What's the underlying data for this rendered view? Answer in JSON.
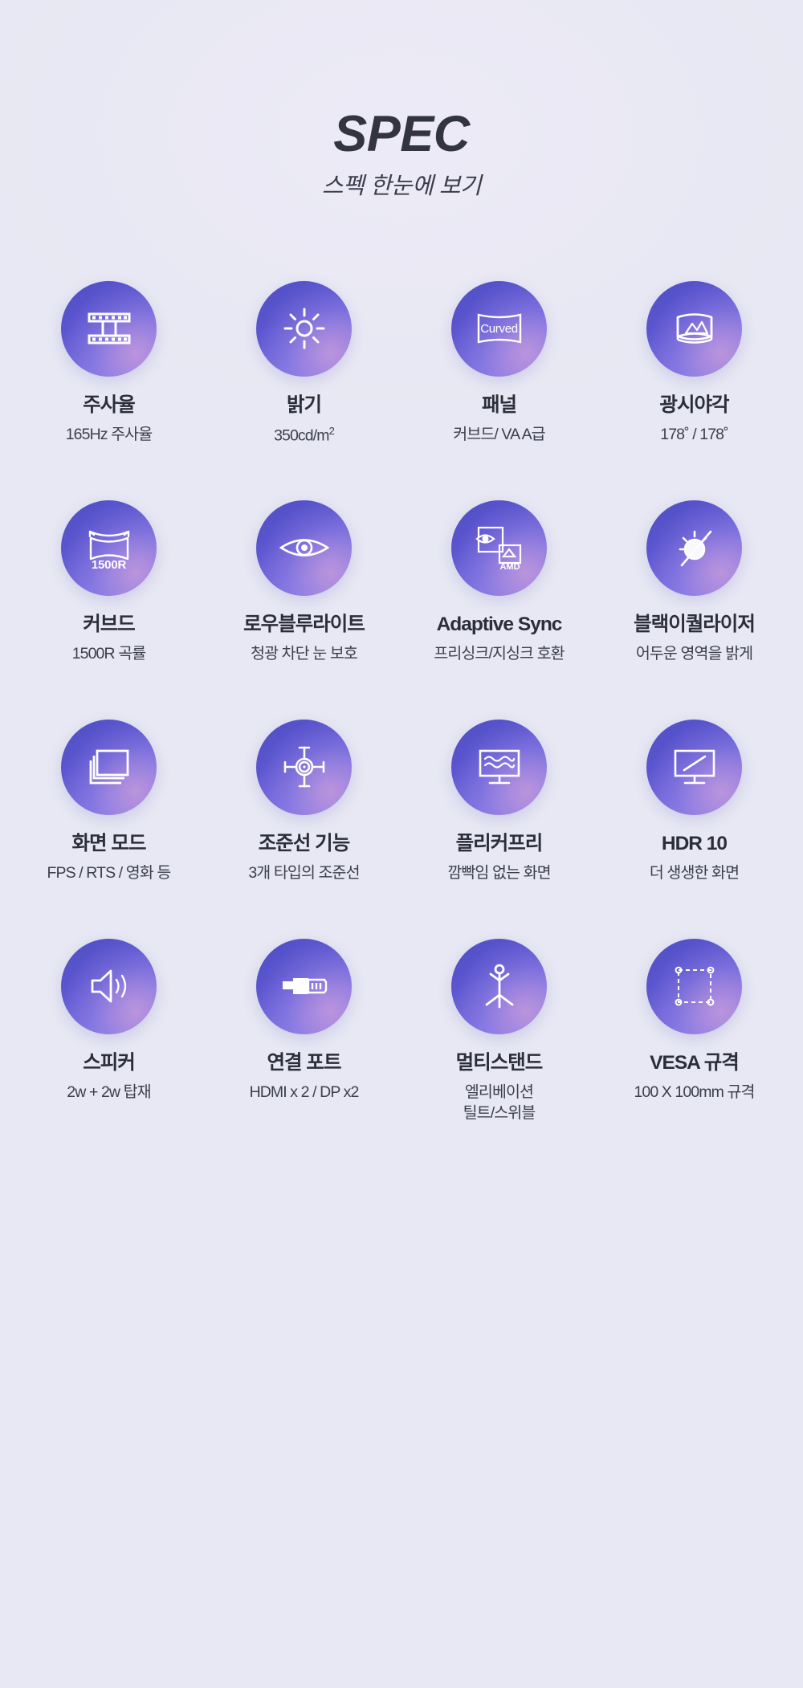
{
  "header": {
    "title": "SPEC",
    "subtitle": "스펙 한눈에 보기"
  },
  "colors": {
    "background": "#e8e8f4",
    "bubble_start": "#4f4fc4",
    "bubble_end": "#8e7ce6",
    "title_text": "#32343f",
    "caption_text": "#2b2d3a",
    "sub_text": "#3c3e4d",
    "icon_stroke": "#ffffff"
  },
  "features": [
    {
      "icon": "film-strip-icon",
      "title": "주사율",
      "sub": "165Hz 주사율",
      "sub2": ""
    },
    {
      "icon": "sun-brightness-icon",
      "title": "밝기",
      "sub": "350cd/m",
      "sub_sup": "2",
      "sub2": ""
    },
    {
      "icon": "curved-panel-icon",
      "icon_label": "Curved",
      "title": "패널",
      "sub": "커브드/ VA A급",
      "sub2": ""
    },
    {
      "icon": "wide-viewing-angle-icon",
      "title": "광시야각",
      "sub": "178˚ / 178˚",
      "sub2": ""
    },
    {
      "icon": "curvature-screen-icon",
      "icon_label": "1500R",
      "title": "커브드",
      "sub": "1500R 곡률",
      "sub2": ""
    },
    {
      "icon": "eye-lowbluelight-icon",
      "title": "로우블루라이트",
      "sub": "청광 차단 눈 보호",
      "sub2": ""
    },
    {
      "icon": "adaptive-sync-amd-icon",
      "icon_label": "AMD",
      "title": "Adaptive Sync",
      "sub": "프리싱크/지싱크 호환",
      "sub2": ""
    },
    {
      "icon": "black-equalizer-icon",
      "title": "블랙이퀄라이저",
      "sub": "어두운 영역을 밝게",
      "sub2": ""
    },
    {
      "icon": "screen-modes-icon",
      "title": "화면 모드",
      "sub": "FPS / RTS / 영화 등",
      "sub2": ""
    },
    {
      "icon": "crosshair-icon",
      "title": "조준선 기능",
      "sub": "3개 타입의 조준선",
      "sub2": ""
    },
    {
      "icon": "flicker-free-monitor-icon",
      "title": "플리커프리",
      "sub": "깜빡임 없는 화면",
      "sub2": ""
    },
    {
      "icon": "hdr-monitor-icon",
      "title": "HDR 10",
      "sub": "더 생생한 화면",
      "sub2": ""
    },
    {
      "icon": "speaker-icon",
      "title": "스피커",
      "sub": "2w + 2w 탑재",
      "sub2": ""
    },
    {
      "icon": "hdmi-port-icon",
      "title": "연결 포트",
      "sub": "HDMI x 2 / DP x2",
      "sub2": ""
    },
    {
      "icon": "multistand-icon",
      "title": "멀티스탠드",
      "sub": "엘리베이션",
      "sub2": "틸트/스위블"
    },
    {
      "icon": "vesa-mount-icon",
      "title": "VESA 규격",
      "sub": "100 X 100mm 규격",
      "sub2": ""
    }
  ]
}
